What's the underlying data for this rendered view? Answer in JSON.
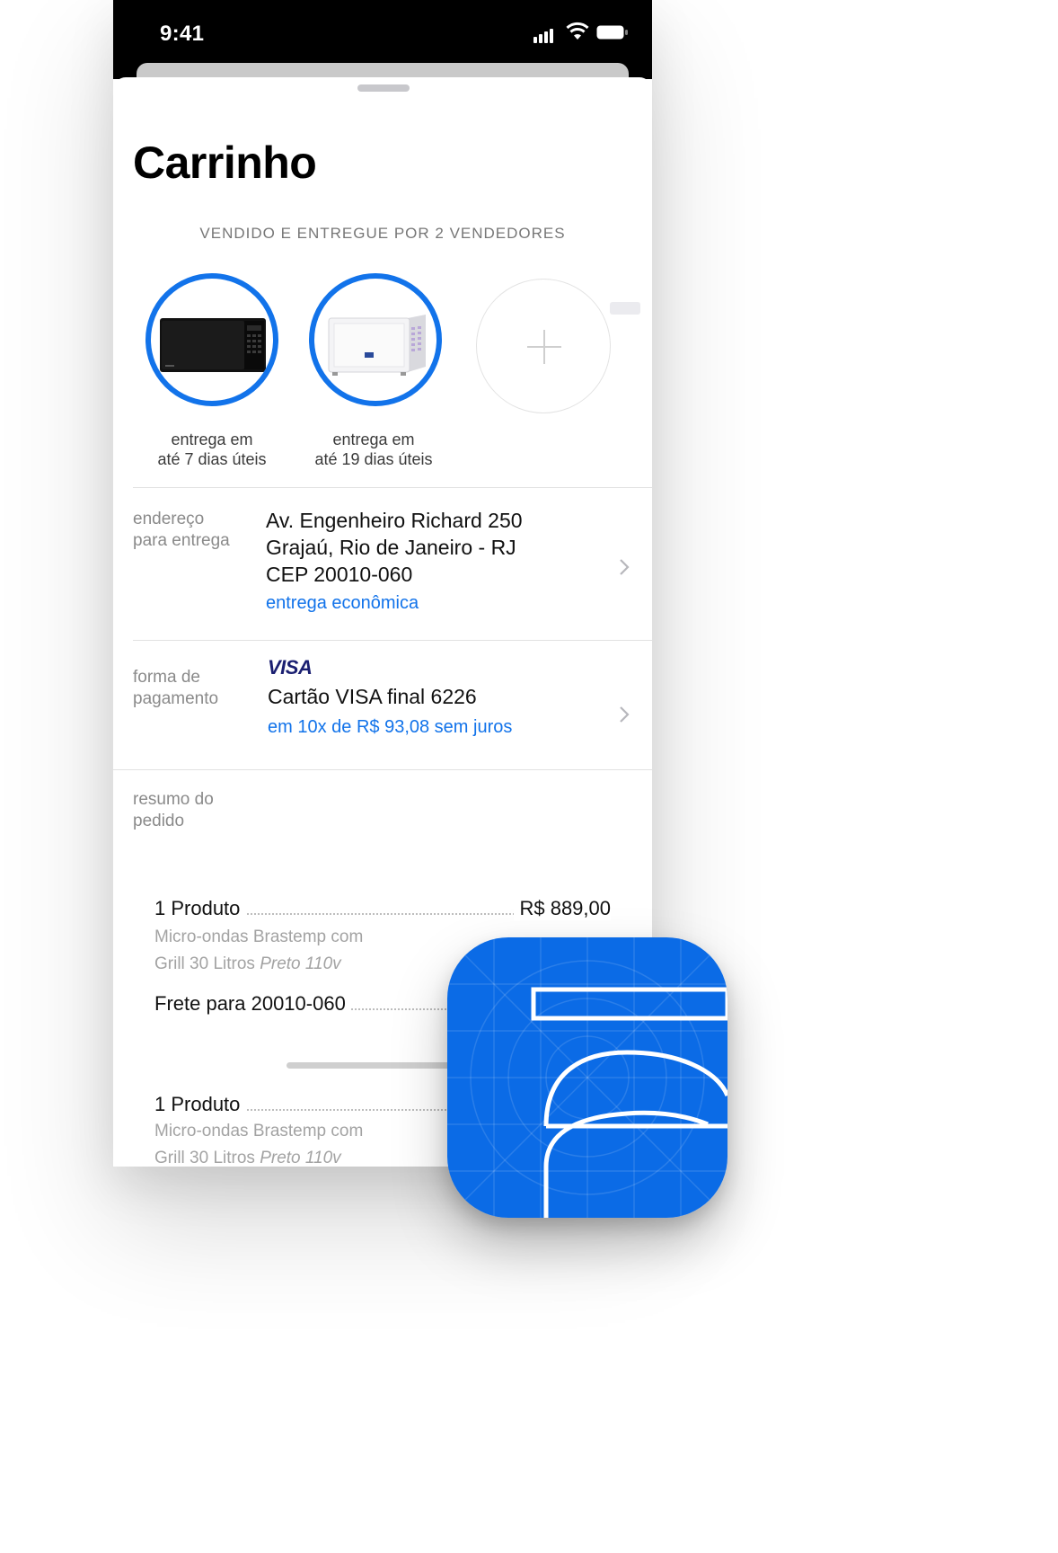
{
  "status_bar": {
    "time": "9:41"
  },
  "cart": {
    "title": "Carrinho",
    "sellers_label": "VENDIDO E ENTREGUE POR 2 VENDEDORES",
    "products": [
      {
        "image": "black-microwave",
        "delivery_line1": "entrega em",
        "delivery_line2": "até 7 dias úteis"
      },
      {
        "image": "white-microwave",
        "delivery_line1": "entrega em",
        "delivery_line2": "até 19 dias úteis"
      }
    ],
    "add_icon": "plus-icon"
  },
  "address": {
    "label_line1": "endereço",
    "label_line2": "para entrega",
    "line1": "Av. Engenheiro Richard 250",
    "line2": "Grajaú, Rio de Janeiro - RJ",
    "line3": "CEP 20010-060",
    "shipping_option": "entrega econômica"
  },
  "payment": {
    "label_line1": "forma de",
    "label_line2": "pagamento",
    "brand": "VISA",
    "card": "Cartão VISA final 6226",
    "installments": "em 10x de R$ 93,08 sem juros"
  },
  "summary": {
    "label_line1": "resumo do",
    "label_line2": "pedido",
    "item1": {
      "label": "1 Produto",
      "price": "R$  889,00",
      "desc_line1": "Micro-ondas Brastemp com",
      "desc_line2_plain": "Grill 30 Litros ",
      "desc_line2_italic": "Preto 110v"
    },
    "shipping": {
      "label": "Frete para 20010-060"
    },
    "item2": {
      "label": "1 Produto",
      "desc_line1": "Micro-ondas Brastemp com",
      "desc_line2_plain": "Grill 30 Litros ",
      "desc_line2_italic": "Preto 110v"
    }
  },
  "colors": {
    "accent": "#1273ea",
    "app_icon_blue": "#0b6be6",
    "visa_blue": "#1a1f71"
  },
  "app_icon": {
    "name": "americanas-app-icon",
    "glyph": "a"
  }
}
